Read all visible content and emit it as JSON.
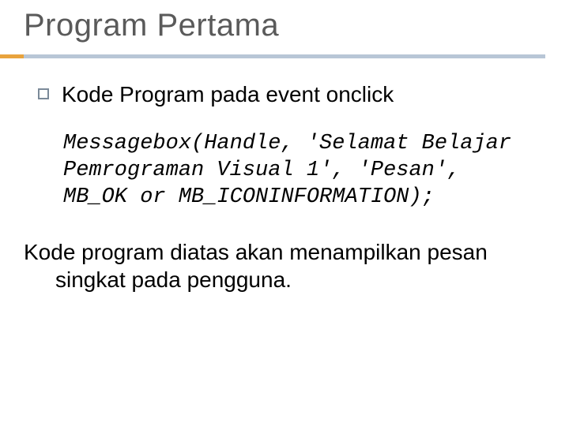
{
  "title": "Program Pertama",
  "bullet": "Kode Program pada event onclick",
  "code": "Messagebox(Handle, 'Selamat Belajar Pemrograman Visual 1', 'Pesan', MB_OK or MB_ICONINFORMATION);",
  "closing_line1": "Kode program diatas akan menampilkan pesan",
  "closing_line2": "singkat pada pengguna."
}
